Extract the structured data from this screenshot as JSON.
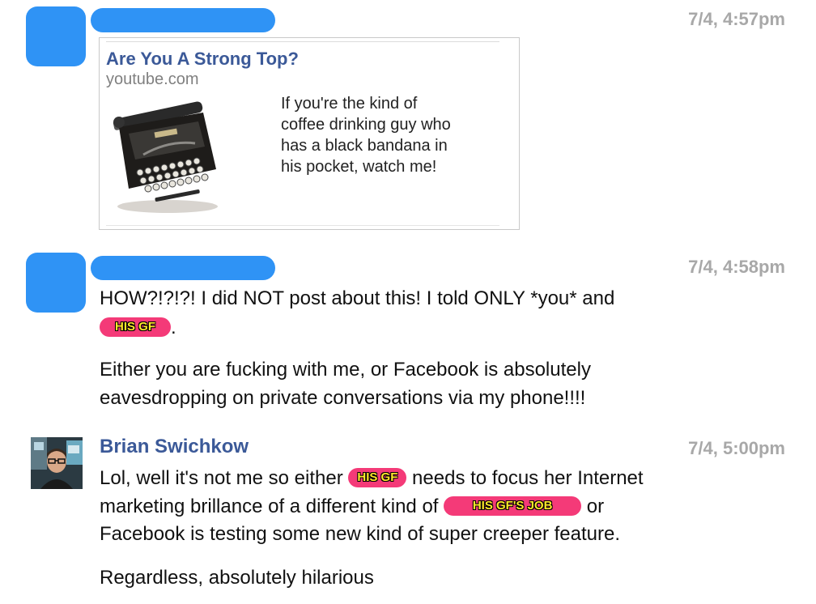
{
  "messages": [
    {
      "timestamp": "7/4, 4:57pm",
      "link": {
        "title": "Are You A Strong Top?",
        "domain": "youtube.com",
        "description_lines": [
          "If you're the kind of",
          "coffee drinking guy who",
          "has a black bandana in",
          "his pocket, watch me!"
        ]
      }
    },
    {
      "timestamp": "7/4, 4:58pm",
      "line1": "HOW?!?!?!  I did NOT post about this!  I told ONLY *you* and",
      "line2_pill": "HIS GF",
      "line2_after": ".",
      "para2_line1": "Either you are fucking with me, or Facebook is absolutely",
      "para2_line2": "eavesdropping on private conversations via my phone!!!!"
    },
    {
      "timestamp": "7/4, 5:00pm",
      "sender": "Brian Swichkow",
      "line1_before": "Lol, well it's not me so either ",
      "line1_pill": "HIS GF",
      "line1_after": " needs to focus her Internet",
      "line2_before": "marketing brillance of a different kind of ",
      "line2_pill": "HIS GF'S JOB",
      "line2_after": " or",
      "line3": "Facebook is testing some new kind of super creeper feature.",
      "para2": "Regardless, absolutely hilarious"
    }
  ],
  "colors": {
    "redaction_blue": "#2f93f5",
    "pill_pink": "#f43a78",
    "pill_text_yellow": "#ffe92a",
    "link_blue": "#3b5998",
    "timestamp_gray": "#a8a8a8"
  },
  "icons": [
    "typewriter-thumbnail",
    "profile-photo"
  ]
}
